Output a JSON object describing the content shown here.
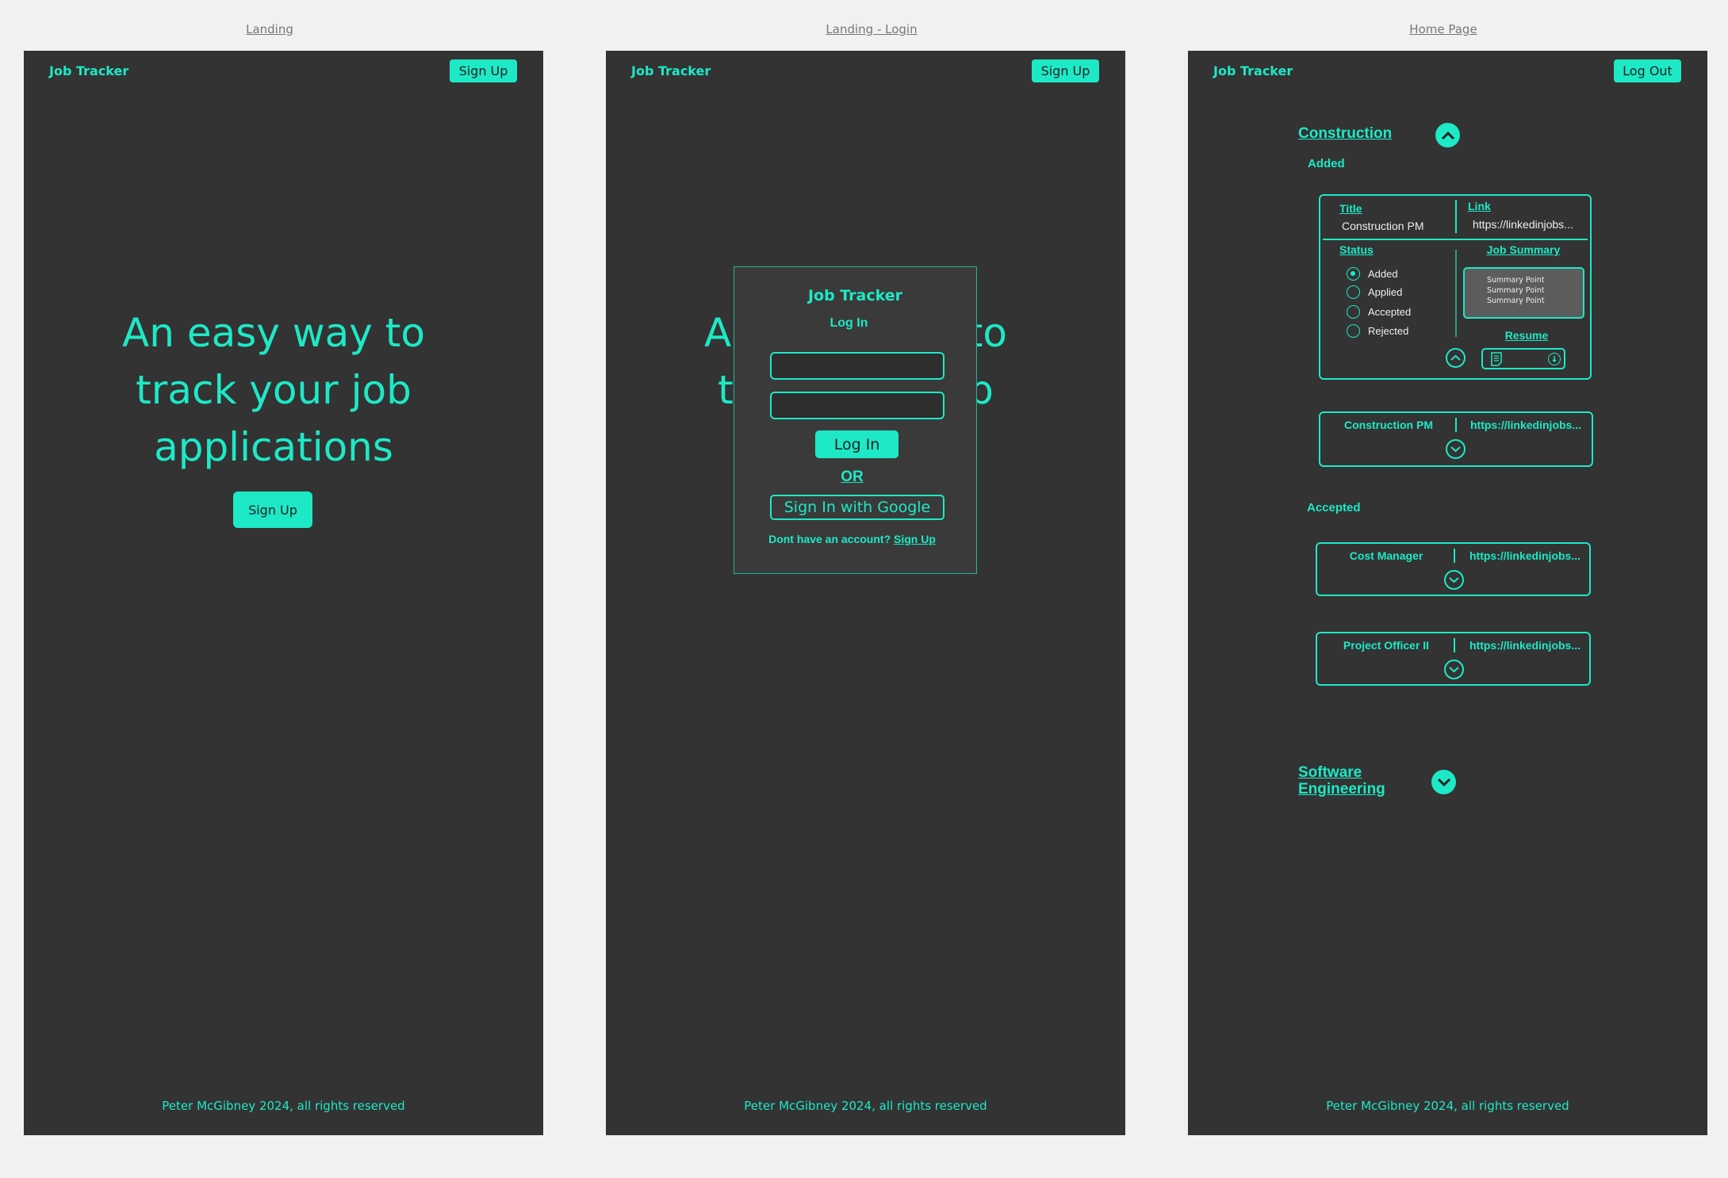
{
  "frame_labels": [
    "Landing",
    "Landing - Login",
    "Home Page"
  ],
  "app_name": "Job Tracker",
  "colors": {
    "accent": "#1de9c6",
    "frame_bg": "#333333",
    "canvas_bg": "#f1f1f1"
  },
  "landing": {
    "header_button": "Sign Up",
    "headline": [
      "An easy way to",
      "track your job",
      "applications"
    ],
    "cta_button": "Sign Up"
  },
  "login": {
    "header_button": "Sign Up",
    "modal_title": "Job Tracker",
    "modal_subtitle": "Log In",
    "username_value": "",
    "password_value": "",
    "login_button": "Log In",
    "or_text": "OR",
    "google_button": "Sign In with Google",
    "no_account_text": "Dont have an account?",
    "signup_link": "Sign Up"
  },
  "home": {
    "header_button": "Log Out",
    "category1": "Construction",
    "category2_line1": "Software",
    "category2_line2": "Engineering",
    "group_added": "Added",
    "group_accepted": "Accepted",
    "expanded": {
      "title_label": "Title",
      "title_value": "Construction PM",
      "link_label": "Link",
      "link_value": "https://linkedinjobs...",
      "status_label": "Status",
      "statuses": [
        "Added",
        "Applied",
        "Accepted",
        "Rejected"
      ],
      "selected_status": "Added",
      "summary_label": "Job Summary",
      "summary_points": [
        "Summary Point",
        "Summary Point",
        "Summary Point"
      ],
      "resume_label": "Resume"
    },
    "cards": [
      {
        "title": "Construction PM",
        "link": "https://linkedinjobs..."
      },
      {
        "title": "Cost Manager",
        "link": "https://linkedinjobs..."
      },
      {
        "title": "Project Officer II",
        "link": "https://linkedinjobs..."
      }
    ]
  },
  "footer": "Peter McGibney 2024, all rights reserved"
}
